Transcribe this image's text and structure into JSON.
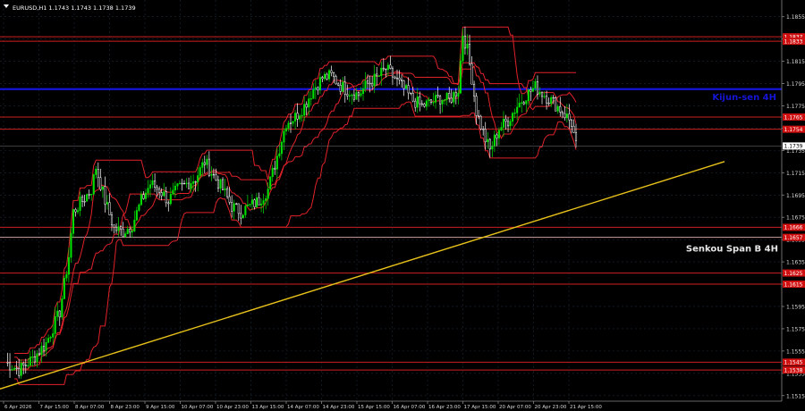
{
  "header": {
    "symbol_line": "EURUSD,H1  1.1743 1.1743 1.1738 1.1739"
  },
  "colors": {
    "background": "#000000",
    "bull": "#00e000",
    "bear": "#ffffff",
    "level": "#cc1f1f",
    "ichimoku": "#e0222a",
    "kijun": "#1515d8",
    "trend": "#e8c21a",
    "label_red": "#d01010"
  },
  "chart_data": {
    "type": "candlestick",
    "symbol": "EURUSD",
    "timeframe": "H1",
    "ylim": [
      1.151,
      1.187
    ],
    "y_ticks": [
      "1.1855",
      "1.1835",
      "1.1815",
      "1.1795",
      "1.1775",
      "1.1755",
      "1.1735",
      "1.1715",
      "1.1695",
      "1.1675",
      "1.1655",
      "1.1635",
      "1.1615",
      "1.1595",
      "1.1575",
      "1.1555",
      "1.1535",
      "1.1515"
    ],
    "x_ticks": [
      "6 Apr 2026",
      "7 Apr 15:00",
      "8 Apr 07:00",
      "8 Apr 23:00",
      "9 Apr 15:00",
      "10 Apr 07:00",
      "10 Apr 23:00",
      "13 Apr 15:00",
      "14 Apr 07:00",
      "14 Apr 23:00",
      "15 Apr 15:00",
      "16 Apr 07:00",
      "16 Apr 23:00",
      "17 Apr 15:00",
      "20 Apr 07:00",
      "20 Apr 23:00",
      "21 Apr 15:00"
    ],
    "current_price": "1.1739",
    "levels": [
      {
        "value": 1.1837,
        "label": "1.1837"
      },
      {
        "value": 1.1833,
        "label": "1.1833"
      },
      {
        "value": 1.1765,
        "label": "1.1765"
      },
      {
        "value": 1.1754,
        "label": "1.1754"
      },
      {
        "value": 1.1666,
        "label": "1.1666"
      },
      {
        "value": 1.1657,
        "label": "1.1657"
      },
      {
        "value": 1.1625,
        "label": "1.1625"
      },
      {
        "value": 1.1615,
        "label": "1.1615"
      },
      {
        "value": 1.1545,
        "label": "1.1545"
      },
      {
        "value": 1.1538,
        "label": "1.1538"
      }
    ],
    "kijun_sen_4h": {
      "value": 1.179,
      "label": "Kijun-sen 4H"
    },
    "senkou_span_b_4h": {
      "value": 1.1657,
      "label": "Senkou Span B 4H"
    },
    "trendline": {
      "from": {
        "bar": 0,
        "price": 1.1521
      },
      "to": {
        "bar": 200,
        "price": 1.1725
      }
    },
    "close_path": [
      [
        0,
        1.1545
      ],
      [
        6,
        1.1538
      ],
      [
        12,
        1.1548
      ],
      [
        18,
        1.1562
      ],
      [
        24,
        1.159
      ],
      [
        28,
        1.164
      ],
      [
        30,
        1.168
      ],
      [
        34,
        1.169
      ],
      [
        38,
        1.17
      ],
      [
        40,
        1.172
      ],
      [
        44,
        1.169
      ],
      [
        48,
        1.1665
      ],
      [
        52,
        1.1662
      ],
      [
        56,
        1.1668
      ],
      [
        60,
        1.169
      ],
      [
        64,
        1.1705
      ],
      [
        68,
        1.17
      ],
      [
        72,
        1.169
      ],
      [
        76,
        1.17
      ],
      [
        80,
        1.1705
      ],
      [
        84,
        1.171
      ],
      [
        88,
        1.1725
      ],
      [
        92,
        1.1712
      ],
      [
        96,
        1.17
      ],
      [
        100,
        1.1685
      ],
      [
        104,
        1.168
      ],
      [
        108,
        1.1685
      ],
      [
        112,
        1.169
      ],
      [
        116,
        1.17
      ],
      [
        120,
        1.173
      ],
      [
        124,
        1.176
      ],
      [
        128,
        1.1765
      ],
      [
        132,
        1.1775
      ],
      [
        136,
        1.179
      ],
      [
        140,
        1.18
      ],
      [
        144,
        1.1802
      ],
      [
        148,
        1.1793
      ],
      [
        152,
        1.1788
      ],
      [
        156,
        1.1785
      ],
      [
        160,
        1.1795
      ],
      [
        164,
        1.18
      ],
      [
        168,
        1.1808
      ],
      [
        172,
        1.18
      ],
      [
        176,
        1.179
      ],
      [
        180,
        1.178
      ],
      [
        184,
        1.1775
      ],
      [
        188,
        1.1778
      ],
      [
        192,
        1.1782
      ],
      [
        196,
        1.178
      ],
      [
        200,
        1.179
      ],
      [
        202,
        1.184
      ],
      [
        204,
        1.1825
      ],
      [
        206,
        1.18
      ],
      [
        208,
        1.177
      ],
      [
        212,
        1.1745
      ],
      [
        214,
        1.1735
      ],
      [
        218,
        1.1755
      ],
      [
        222,
        1.1762
      ],
      [
        226,
        1.1775
      ],
      [
        230,
        1.1785
      ],
      [
        234,
        1.1792
      ],
      [
        238,
        1.1785
      ],
      [
        242,
        1.1778
      ],
      [
        246,
        1.177
      ],
      [
        250,
        1.176
      ],
      [
        252,
        1.1739
      ]
    ]
  }
}
